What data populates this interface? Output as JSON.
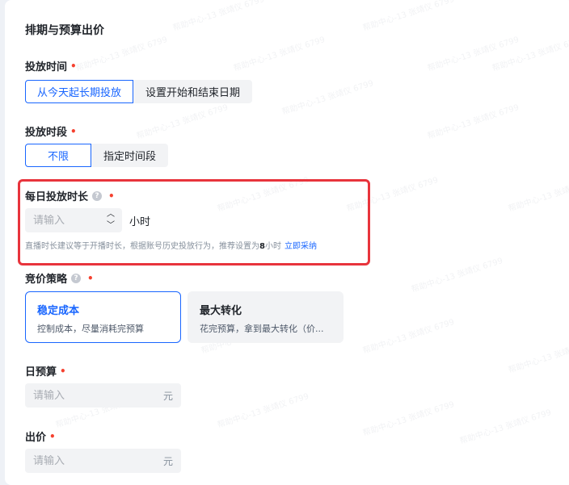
{
  "section": {
    "title": "排期与预算出价"
  },
  "schedule_time": {
    "label": "投放时间",
    "options": [
      "从今天起长期投放",
      "设置开始和结束日期"
    ],
    "selected": "从今天起长期投放"
  },
  "schedule_slot": {
    "label": "投放时段",
    "options": [
      "不限",
      "指定时间段"
    ],
    "selected": "不限"
  },
  "daily_duration": {
    "label": "每日投放时长",
    "placeholder": "请输入",
    "unit": "小时",
    "hint_prefix": "直播时长建议等于开播时长，根据账号历史投放行为，推荐设置为",
    "hint_value": "8",
    "hint_suffix": "小时",
    "hint_link": "立即采纳"
  },
  "bid_strategy": {
    "label": "竞价策略",
    "options": [
      {
        "title": "稳定成本",
        "desc": "控制成本，尽量消耗完预算"
      },
      {
        "title": "最大转化",
        "desc": "花完预算，拿到最大转化（价..."
      }
    ],
    "selected": "稳定成本"
  },
  "daily_budget": {
    "label": "日预算",
    "placeholder": "请输入",
    "currency": "元"
  },
  "bid": {
    "label": "出价",
    "placeholder": "请输入",
    "currency": "元"
  },
  "colors": {
    "accent": "#1966ff",
    "required": "#f5412f",
    "highlight": "#e8343c"
  }
}
